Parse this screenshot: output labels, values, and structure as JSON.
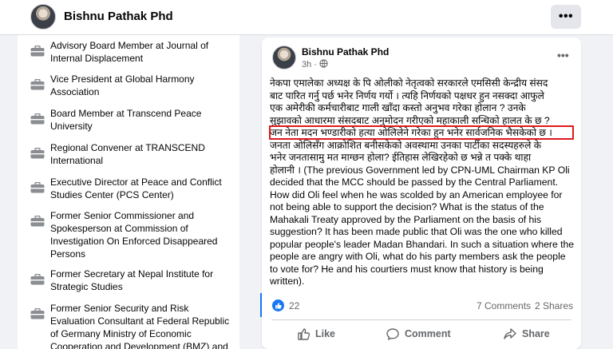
{
  "profile": {
    "name": "Bishnu Pathak Phd",
    "more_label": "•••"
  },
  "intro": {
    "icon": "briefcase-icon",
    "items": [
      {
        "text": "Advisory Board Member at Journal of Internal Displacement"
      },
      {
        "text": "Vice President at Global Harmony Association"
      },
      {
        "text": "Board Member at Transcend Peace University"
      },
      {
        "text": "Regional Convener at TRANSCEND International"
      },
      {
        "text": "Executive Director at Peace and Conflict Studies Center (PCS Center)"
      },
      {
        "text": "Former Senior Commissioner and Spokesperson at Commission of Investigation On Enforced Disappeared Persons"
      },
      {
        "text": "Former Secretary at Nepal Institute for Strategic Studies"
      },
      {
        "text": "Former Senior Security and Risk Evaluation Consultant at Federal Republic of Germany Ministry of Economic Cooperation and Development (BMZ) and RRN"
      }
    ]
  },
  "post": {
    "author": "Bishnu Pathak Phd",
    "time": "3h",
    "dot": "·",
    "more_label": "•••",
    "lines": [
      "नेकपा एमालेका अध्यक्ष के पि ओलीको नेतृत्वको सरकारले एमसिसी केन्द्रीय संसद",
      "बाट पारित गर्नु पर्छ भनेर निर्णय गर्यो । त्यहि निर्णयको पक्षधर हुन नसक्दा आफुले",
      "एक अमेरीकी कर्मचारीबाट गाली खाँदा कस्तो अनुभव गरेका होलान ? उनके",
      "सुझावको आधारमा संसदबाट अनुमोदन गरीएको महाकाली सन्धिको हालत के छ ?",
      "जन नेता मदन भण्डारीको हत्या ओलिलेने गरेका हुन भनेर सार्वजनिक भैसकेको छ ।",
      "जनता ओलिसँग आक्रोशित बनीसकेको अवस्थामा उनका पार्टीका सदस्यहरुले के",
      "भनेर जनतासामु मत माग्छन होला? ईतिहास लेखिरहेको छ भन्ने त पक्के थाहा",
      "होलानी ।  (The previous Government led by CPN-UML Chairman KP Oli",
      "decided that the MCC should be passed by the Central Parliament.",
      "How did Oli feel when he was scolded by an American employee for",
      "not being able to support the decision? What is the status of the",
      "Mahakali Treaty approved by the Parliament on the basis of his",
      "suggestion? It has been made public that Oli was the one who killed",
      "popular people's leader Madan Bhandari. In such a situation where the",
      "people are angry with Oli, what do his party members ask the people",
      "to vote for? He and his courtiers must know that history is being",
      "written)."
    ],
    "reactions_count": "22",
    "comments_label": "7 Comments",
    "shares_label": "2 Shares",
    "actions": {
      "like": "Like",
      "comment": "Comment",
      "share": "Share"
    },
    "highlight_color": "#e0191b"
  },
  "colors": {
    "accent": "#1877f2",
    "muted": "#65676b",
    "page_bg": "#f0f2f5"
  }
}
